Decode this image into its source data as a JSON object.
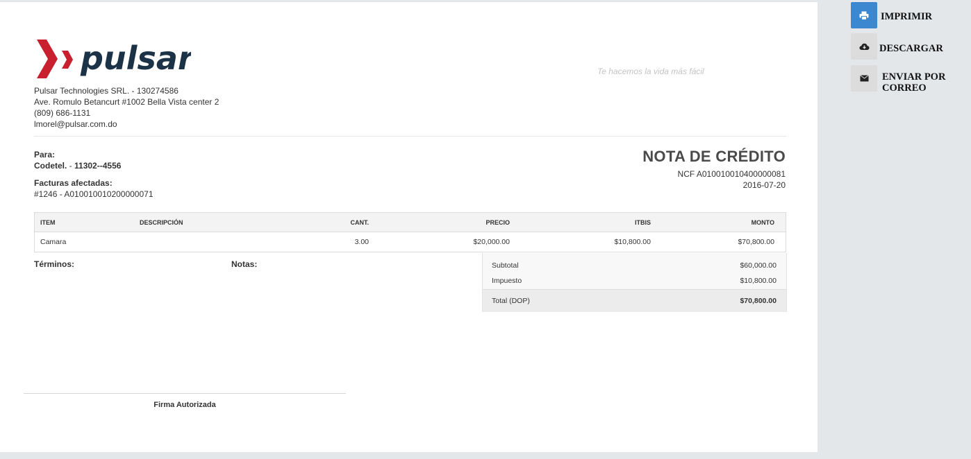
{
  "company": {
    "logo_text": "pulsar",
    "name_line": "Pulsar Technologies SRL. - 130274586",
    "address": "Ave. Romulo Betancurt #1002 Bella Vista center 2",
    "phone": "(809) 686-1131",
    "email": "lmorel@pulsar.com.do",
    "slogan": "Te hacemos la vida más fácil"
  },
  "client": {
    "label": "Para:",
    "name": "Codetel.",
    "separator": " - ",
    "id": "11302--4556",
    "invoices_label": "Facturas afectadas:",
    "invoices_value": "#1246 - A010010010200000071"
  },
  "document": {
    "title": "NOTA DE CRÉDITO",
    "ncf": "NCF A010010010400000081",
    "date": "2016-07-20"
  },
  "table": {
    "headers": {
      "item": "ITEM",
      "description": "DESCRIPCIÓN",
      "qty": "CANT.",
      "price": "PRECIO",
      "tax": "ITBIS",
      "amount": "MONTO"
    },
    "rows": [
      {
        "item": "Camara",
        "description": "",
        "qty": "3.00",
        "price": "$20,000.00",
        "tax": "$10,800.00",
        "amount": "$70,800.00"
      }
    ]
  },
  "footer": {
    "terms_label": "Términos:",
    "notes_label": "Notas:",
    "signature_label": "Firma Autorizada"
  },
  "totals": {
    "subtotal_label": "Subtotal",
    "subtotal_value": "$60,000.00",
    "tax_label": "Impuesto",
    "tax_value": "$10,800.00",
    "total_label": "Total (DOP)",
    "total_value": "$70,800.00"
  },
  "actions": {
    "print": "IMPRIMIR",
    "download": "DESCARGAR",
    "email_line1": "ENVIAR POR",
    "email_line2": "CORREO"
  },
  "colors": {
    "logo_red": "#c8202f",
    "logo_navy": "#1c3247",
    "primary_button": "#3b88d0",
    "secondary_button": "#dcdcdc",
    "sidebar_bg": "#e4e7ea"
  },
  "icons": {
    "print": "print-icon",
    "download": "cloud-download-icon",
    "email": "envelope-icon"
  }
}
